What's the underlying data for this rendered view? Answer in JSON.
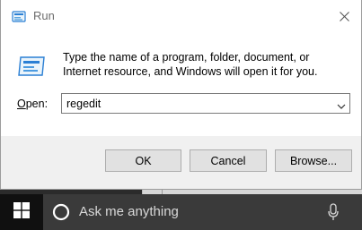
{
  "window": {
    "title": "Run",
    "description": "Type the name of a program, folder, document, or Internet resource, and Windows will open it for you.",
    "open_label_accel": "O",
    "open_label_rest": "pen:",
    "open_value": "regedit"
  },
  "buttons": {
    "ok": "OK",
    "cancel": "Cancel",
    "browse": "Browse..."
  },
  "taskbar": {
    "search_placeholder": "Ask me anything"
  },
  "icons": {
    "title": "run-icon",
    "close": "close-icon",
    "dropdown": "chevron-down-icon",
    "start": "windows-logo-icon",
    "search": "cortana-circle-icon",
    "mic": "microphone-icon"
  },
  "colors": {
    "titlebar": "#ffffff",
    "dialog_bg": "#f0f0f0",
    "button_bg": "#e1e1e1",
    "taskbar": "#101010",
    "search_box": "#3a3a3a",
    "accent_blue": "#2a7fd4"
  }
}
